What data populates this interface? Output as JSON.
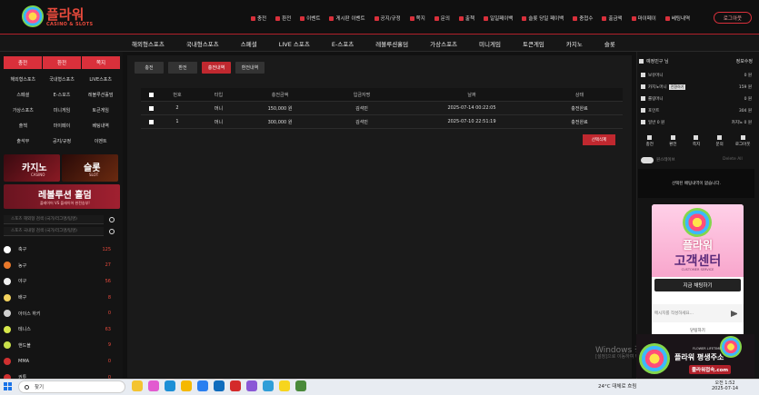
{
  "header": {
    "brand": "플라워",
    "brand_sub": "CASINO & SLOTS",
    "nav": [
      "충전",
      "환전",
      "이벤트",
      "게시판 이벤트",
      "공지/규정",
      "쪽지",
      "문의",
      "출첵",
      "일일페이백",
      "슬롯 당일 페이백",
      "충첩수",
      "출금액",
      "마이페이",
      "베팅내역"
    ],
    "logout_label": "로그아웃"
  },
  "main_nav": [
    "해외형스포츠",
    "국내형스포츠",
    "스페셜",
    "LIVE 스포츠",
    "E-스포츠",
    "레볼루션홀덤",
    "가상스포츠",
    "미니게임",
    "토큰게임",
    "카지노",
    "슬롯"
  ],
  "left": {
    "tabs": [
      "충전",
      "환전",
      "쪽지"
    ],
    "grid": [
      [
        "해외형스포츠",
        "국내형스포츠",
        "LIVE스포츠"
      ],
      [
        "스페셜",
        "E-스포츠",
        "레볼루션홀덤"
      ],
      [
        "가상스포츠",
        "미니게임",
        "토큰게임"
      ],
      [
        "출첵",
        "마이페이",
        "베팅내역"
      ],
      [
        "출석부",
        "공지/규정",
        "이벤트"
      ]
    ],
    "banners": {
      "casino": "카지노",
      "casino_sub": "CASINO",
      "slot": "슬롯",
      "slot_sub": "SLOT",
      "holdem": "레볼루션 홀덤",
      "holdem_sub": "플레이어 VS 플레이어 완전승부!"
    },
    "search1_placeholder": "스포츠 해외형 검색 (국가/리그명/팀명)",
    "search2_placeholder": "스포츠 국내형 검색 (국가/리그명/팀명)",
    "sports": [
      {
        "name": "축구",
        "count": "125",
        "color": "#ffffff"
      },
      {
        "name": "농구",
        "count": "27",
        "color": "#e8782a"
      },
      {
        "name": "야구",
        "count": "56",
        "color": "#f0f0f0"
      },
      {
        "name": "배구",
        "count": "8",
        "color": "#f4d35e"
      },
      {
        "name": "아이스 하키",
        "count": "0",
        "color": "#d0d0d0"
      },
      {
        "name": "테니스",
        "count": "63",
        "color": "#d7e84a"
      },
      {
        "name": "핸드볼",
        "count": "9",
        "color": "#c8e04a"
      },
      {
        "name": "MMA",
        "count": "0",
        "color": "#d03030"
      },
      {
        "name": "권투",
        "count": "0",
        "color": "#d03030"
      }
    ]
  },
  "content": {
    "tabs": [
      "충전",
      "환전",
      "충전내역",
      "환전내역"
    ],
    "active_tab": 2,
    "columns": [
      "번호",
      "타입",
      "충전금액",
      "입금자명",
      "날짜",
      "상태"
    ],
    "rows": [
      {
        "no": "2",
        "type": "머니",
        "amount": "150,000 원",
        "name": "김석민",
        "date": "2025-07-14 00:22:05",
        "status": "충전완료"
      },
      {
        "no": "1",
        "type": "머니",
        "amount": "300,000 원",
        "name": "김석민",
        "date": "2025-07-10 22:51:19",
        "status": "충전완료"
      }
    ],
    "delete_label": "선택삭제"
  },
  "right": {
    "user": "예정민구 님",
    "info": "정보수정",
    "rows": [
      {
        "label": "보유머니",
        "value": "0 원"
      },
      {
        "label": "카지노머니",
        "badge": "전환하기",
        "value": "159 원"
      },
      {
        "label": "롤링머니",
        "value": "0 원"
      },
      {
        "label": "포인트",
        "value": "304 원"
      },
      {
        "label": "일반 0 원",
        "value": "카지노 0 원"
      }
    ],
    "icons": [
      "충전",
      "환전",
      "쪽지",
      "문의",
      "로그아웃"
    ],
    "toggle_label": "원스테이브",
    "toggle_right": "Delete All",
    "slip_text": "선택된 배팅내역이 없습니다."
  },
  "chat": {
    "brand": "플라워",
    "title": "고객센터",
    "sub": "CUSTOMER SERVICE",
    "button": "지금 채팅하기",
    "placeholder": "메시지를 작성하세요...",
    "close": "닫팅하기"
  },
  "watermark": {
    "line1": "Windows 정품 인증",
    "line2": "[설정]으로 이동하여 Windows를 정품 인증합니다."
  },
  "promo": {
    "t1": "FLOWER LIFETIME",
    "t2": "플라워 평생주소",
    "t3": "플라워접속.com"
  },
  "taskbar": {
    "search": "찾기",
    "weather": "24°C 대체로 흐림",
    "time": "오전 1:52",
    "date": "2025-07-14"
  }
}
